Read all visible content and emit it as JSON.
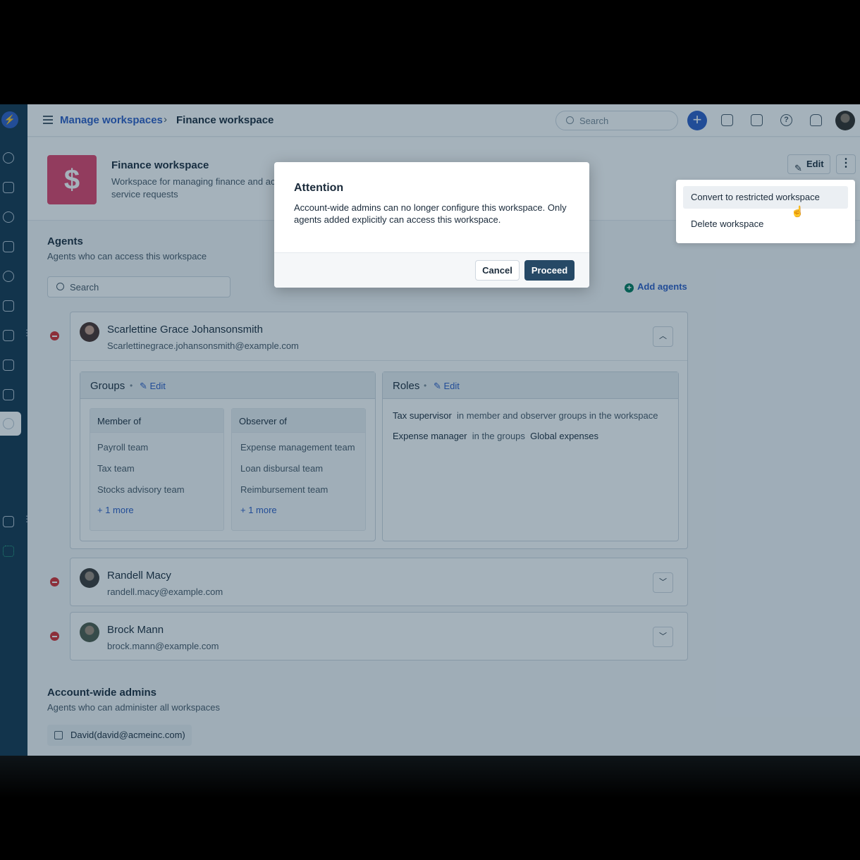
{
  "topbar": {
    "breadcrumb_parent": "Manage workspaces",
    "breadcrumb_separator": "›",
    "breadcrumb_current": "Finance workspace",
    "search_placeholder": "Search",
    "new_label": "+"
  },
  "workspace": {
    "logo_symbol": "$",
    "logo_color": "#e1416a",
    "title": "Finance workspace",
    "description": "Workspace for managing finance and ac service requests",
    "edit_label": "Edit",
    "more_label": "⋮"
  },
  "menu": {
    "items": [
      {
        "label": "Convert to restricted workspace"
      },
      {
        "label": "Delete workspace"
      }
    ]
  },
  "modal": {
    "title": "Attention",
    "body": "Account-wide admins can no longer configure this workspace. Only agents added explicitly can access this workspace.",
    "cancel_label": "Cancel",
    "proceed_label": "Proceed"
  },
  "agents": {
    "title": "Agents",
    "subtitle": "Agents who can access this workspace",
    "search_placeholder": "Search",
    "add_label": "Add agents",
    "list": [
      {
        "name": "Scarlettine Grace Johansonsmith",
        "email": "Scarlettinegrace.johansonsmith@example.com",
        "groups_label": "Groups",
        "groups_edit": "Edit",
        "member_header": "Member of",
        "member_items": [
          "Payroll team",
          "Tax team",
          "Stocks advisory team"
        ],
        "member_more": "+ 1 more",
        "observer_header": "Observer of",
        "observer_items": [
          "Expense management team",
          "Loan disbursal team",
          "Reimbursement team"
        ],
        "observer_more": "+ 1 more",
        "roles_label": "Roles",
        "roles_edit": "Edit",
        "roles": [
          {
            "role": "Tax supervisor",
            "scope": "in member and observer groups in the workspace",
            "group": ""
          },
          {
            "role": "Expense manager",
            "scope": "in the groups",
            "group": "Global expenses"
          }
        ]
      },
      {
        "name": "Randell Macy",
        "email": "randell.macy@example.com"
      },
      {
        "name": "Brock Mann",
        "email": "brock.mann@example.com"
      }
    ]
  },
  "admins": {
    "title": "Account-wide admins",
    "subtitle": "Agents who can administer all workspaces",
    "chip": "David(david@acmeinc.com)"
  },
  "colors": {
    "brand": "#2c5cc5",
    "sidebar": "#12344d",
    "primary_button": "#264966",
    "remove": "#d72d30"
  }
}
